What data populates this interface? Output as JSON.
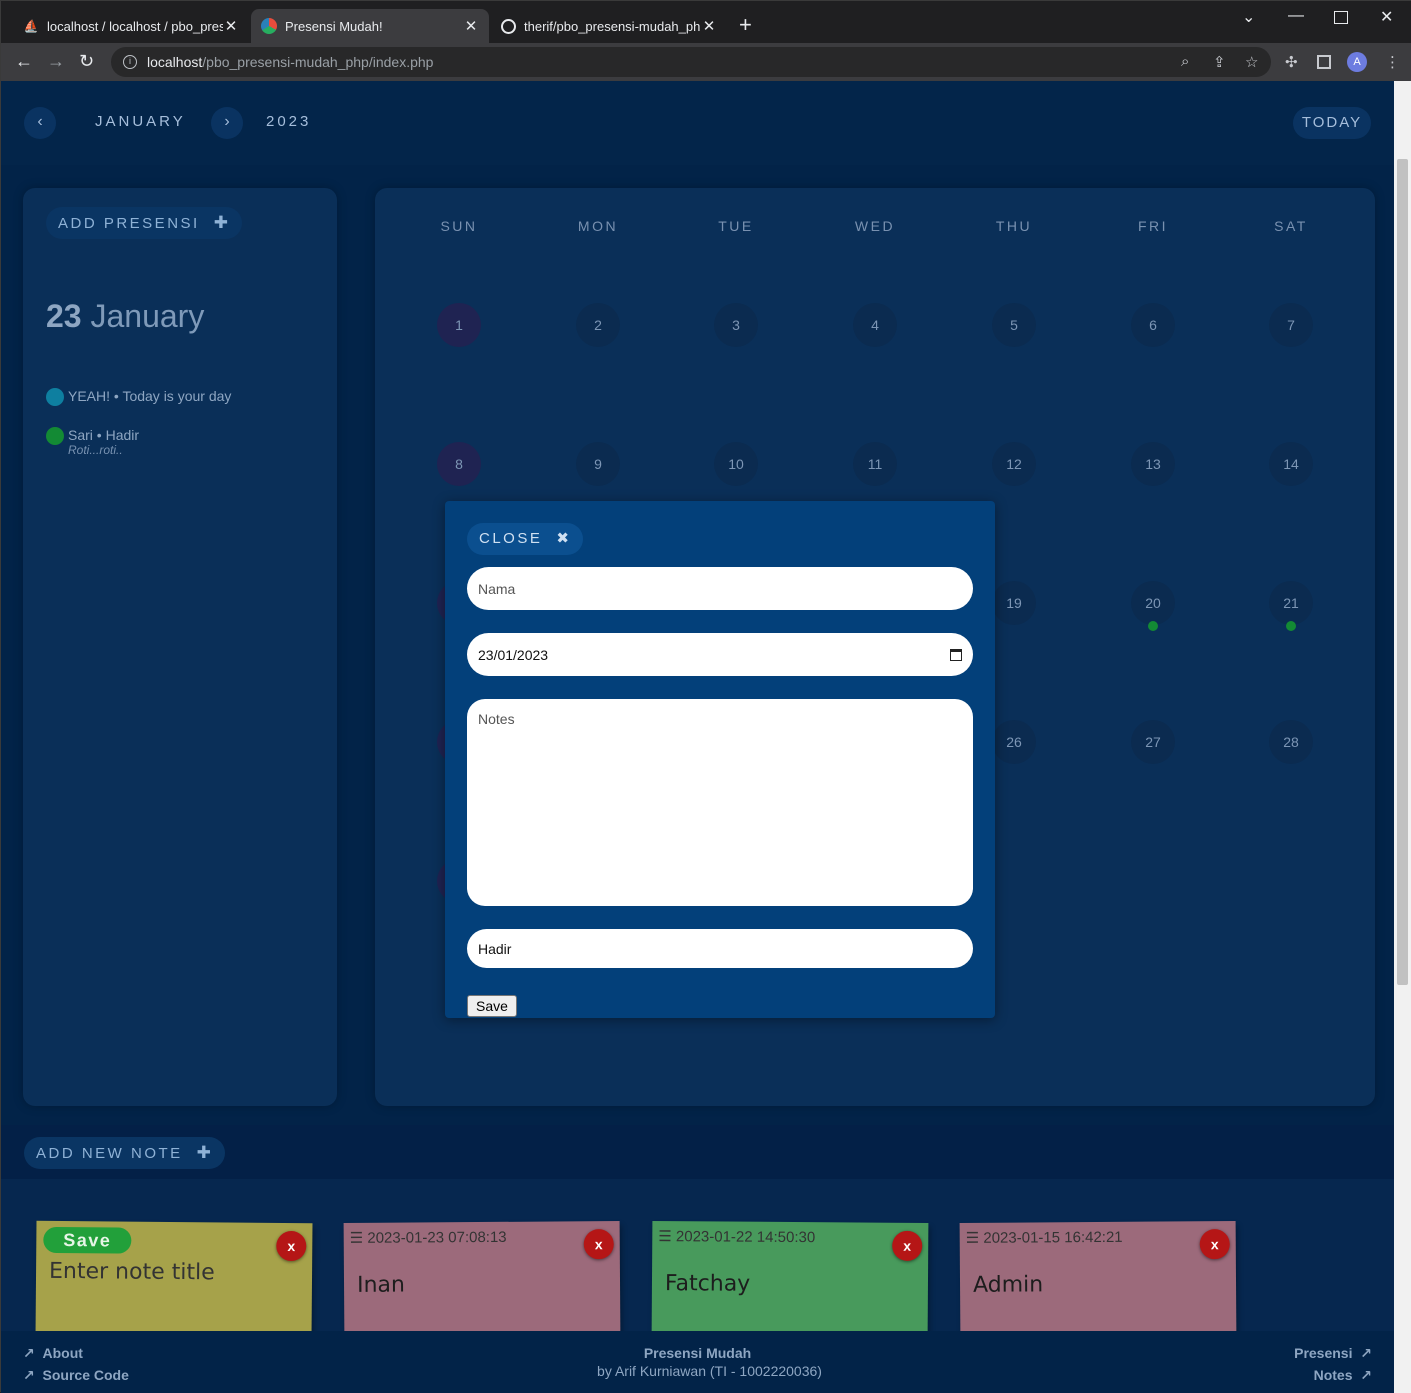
{
  "browser": {
    "tabs": [
      {
        "title": "localhost / localhost / pbo_prese",
        "icon": "phpmyadmin-icon"
      },
      {
        "title": "Presensi Mudah!",
        "icon": "app-icon"
      },
      {
        "title": "therif/pbo_presensi-mudah_php:",
        "icon": "github-icon"
      }
    ],
    "url_host": "localhost",
    "url_path": "/pbo_presensi-mudah_php/index.php",
    "profile_initial": "A"
  },
  "header": {
    "month": "JANUARY",
    "year": "2023",
    "prev_symbol": "‹",
    "next_symbol": "›",
    "today_label": "TODAY"
  },
  "sidebar": {
    "add_label": "ADD PRESENSI",
    "selected_day": "23",
    "selected_month": "January",
    "events": [
      {
        "title": "YEAH! • Today is your day",
        "note": "",
        "color": "#0e7fa0"
      },
      {
        "title": "Sari • Hadir",
        "note": "Roti...roti..",
        "color": "#138a34"
      }
    ]
  },
  "calendar": {
    "weekdays": [
      "SUN",
      "MON",
      "TUE",
      "WED",
      "THU",
      "FRI",
      "SAT"
    ],
    "weeks": [
      [
        "1",
        "2",
        "3",
        "4",
        "5",
        "6",
        "7"
      ],
      [
        "8",
        "9",
        "10",
        "11",
        "12",
        "13",
        "14"
      ],
      [
        "",
        "",
        "",
        "",
        "19",
        "20",
        "21"
      ],
      [
        "",
        "",
        "",
        "",
        "26",
        "27",
        "28"
      ]
    ],
    "event_days": [
      "20",
      "21"
    ],
    "event_color": "#138a34"
  },
  "modal": {
    "close_label": "CLOSE",
    "name_placeholder": "Nama",
    "date_value": "23/01/2023",
    "notes_placeholder": "Notes",
    "status_value": "Hadir",
    "save_label": "Save"
  },
  "notes": {
    "add_label": "ADD NEW NOTE",
    "new_note": {
      "save_label": "Save",
      "title_placeholder": "Enter note title",
      "color": "#a6a24a"
    },
    "items": [
      {
        "timestamp": "2023-01-23 07:08:13",
        "name": "Inan",
        "color": "#9c6a7b"
      },
      {
        "timestamp": "2023-01-22 14:50:30",
        "name": "Fatchay",
        "color": "#489a5c"
      },
      {
        "timestamp": "2023-01-15 16:42:21",
        "name": "Admin",
        "color": "#9c6a7b"
      }
    ],
    "delete_label": "x"
  },
  "footer": {
    "about": "About",
    "source_code": "Source Code",
    "app_name": "Presensi Mudah",
    "credit": "by Arif Kurniawan (TI - 1002220036)",
    "presensi": "Presensi",
    "notes": "Notes"
  }
}
